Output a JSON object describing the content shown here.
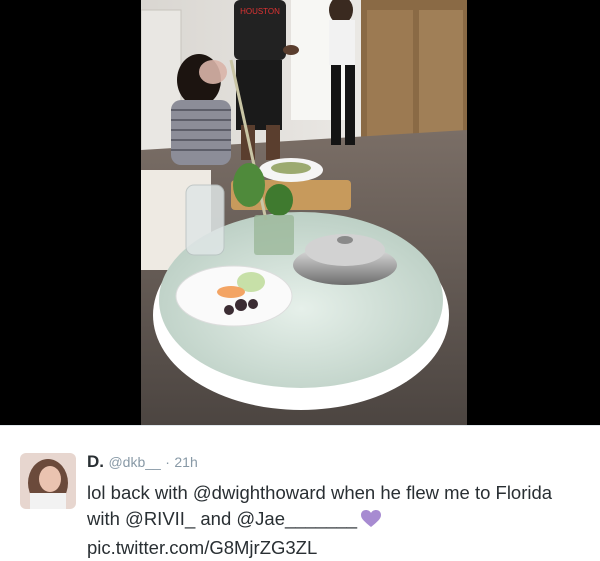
{
  "tweet": {
    "display_name": "D.",
    "handle": "@dkb__",
    "separator": "·",
    "time": "21h",
    "text_part1": "lol back with ",
    "mention1": "@dwighthoward",
    "text_part2": " when he flew me to Florida with ",
    "mention2": "@RIVII_",
    "text_part3": " and ",
    "mention3": "@Jae_______",
    "emoji": "purple-heart",
    "link": "pic.twitter.com/G8MjrZG3ZL",
    "link_color": "#000000",
    "text_color": "#292f33",
    "meta_color": "#8899a6",
    "heart_color": "#a78bd1"
  },
  "photo": {
    "shirt_text": "HOUSTON"
  }
}
